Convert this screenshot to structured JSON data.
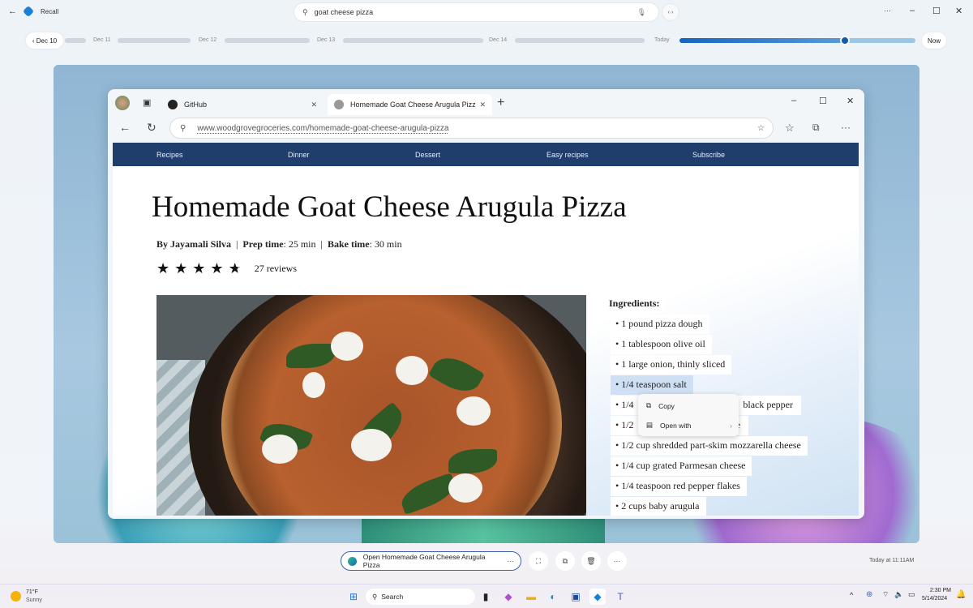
{
  "app": {
    "title": "Recall",
    "search_value": "goat cheese pizza"
  },
  "timeline": {
    "start": "Dec 10",
    "labels": [
      "Dec 11",
      "Dec 12",
      "Dec 13",
      "Dec 14",
      "Today"
    ],
    "now": "Now",
    "position_percent": 70
  },
  "browser": {
    "tabs": [
      {
        "label": "GitHub"
      },
      {
        "label": "Homemade Goat Cheese Arugula Pizz",
        "active": true
      }
    ],
    "url": "www.woodgrovegroceries.com/homemade-goat-cheese-arugula-pizza"
  },
  "site": {
    "nav": [
      "Recipes",
      "Dinner",
      "Dessert",
      "Easy recipes",
      "Subscribe"
    ],
    "title": "Homemade Goat Cheese Arugula Pizza",
    "author_label": "By Jayamali Silva",
    "prep_label": "Prep time",
    "prep_value": ": 25 min",
    "bake_label": "Bake time",
    "bake_value": ": 30 min",
    "sep": "|",
    "rating": 4.5,
    "reviews": "27 reviews",
    "ingredients_title": "Ingredients:",
    "ingredients": [
      "1 pound pizza dough",
      "1 tablespoon olive oil",
      "1 large onion, thinly sliced",
      "1/4 teaspoon salt",
      "1/4 teaspoon black pepper",
      "1/2 cup crumbled goat cheese",
      "1/2 cup shredded part-skim mozzarella cheese",
      "1/4 cup grated Parmesan cheese",
      "1/4 teaspoon red pepper flakes",
      "2 cups baby arugula"
    ],
    "ing_visible": [
      "1/4",
      "black pepper",
      "1/2",
      "e"
    ]
  },
  "context_menu": {
    "copy": "Copy",
    "open_with": "Open with"
  },
  "actions": {
    "open_label": "Open Homemade Goat Cheese Arugula Pizza",
    "timestamp": "Today at 11:11AM"
  },
  "taskbar": {
    "search": "Search",
    "time": "2:30 PM",
    "date": "5/14/2024"
  },
  "weather": {
    "temp": "71°F",
    "cond": "Sunny"
  },
  "colors": {
    "accent": "#0f6cbd",
    "nav": "#203e6b",
    "selection": "#cfe0f5"
  }
}
